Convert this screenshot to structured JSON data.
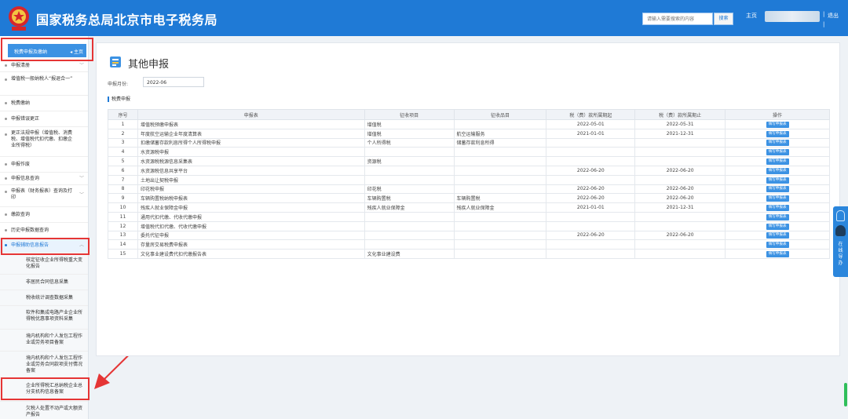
{
  "header": {
    "site_title": "国家税务总局北京市电子税务局",
    "search_placeholder": "请输入需要搜索的内容",
    "search_button": "搜索",
    "home_link": "主页",
    "separator": "|",
    "logout_link": "退出",
    "brand_color": "#1f7ad6"
  },
  "sidebar": {
    "head_label": "税费申报及缴纳",
    "head_home": "◂ 主页",
    "items": [
      {
        "label": "申报清册",
        "chev": "﹀"
      },
      {
        "label": "增值税一般纳税人“报退合一”",
        "chev": ""
      },
      {
        "label": "税费缴纳",
        "chev": ""
      },
      {
        "label": "申报错误更正",
        "chev": ""
      },
      {
        "label": "更正法规申报（增值税、消费税、增值税代扣代缴、扣缴企业所得税）",
        "chev": ""
      },
      {
        "label": "申报作废",
        "chev": ""
      },
      {
        "label": "申报信息查询",
        "chev": "﹀"
      },
      {
        "label": "申报表（财务报表）查询及打印",
        "chev": "﹀"
      },
      {
        "label": "缴款查询",
        "chev": ""
      },
      {
        "label": "历史申报数据查询",
        "chev": ""
      },
      {
        "label": "申报辅助信息报告",
        "chev": "︿"
      }
    ],
    "sub_items": [
      "核定征收企业所得税重大变化报告",
      "非居民合同信息采集",
      "税收统计调查数据采集",
      "软件和集成电路产业企业所得税优惠事项资料采集",
      "境内机构和个人发包工程作业或劳务项目备案",
      "境内机构和个人发包工程作业或劳务合同款项支付情况备案",
      "企业所得税汇总纳税企业总分支机构信息备案",
      "欠税人处置不动产或大额资产报告"
    ]
  },
  "main": {
    "title": "其他申报",
    "period_label": "申报月份:",
    "period_value": "2022-06",
    "section_title": "税费申报",
    "columns": [
      "序号",
      "申报表",
      "征收项目",
      "征收品目",
      "税（费）款所属期起",
      "税（费）款所属期止",
      "操作"
    ],
    "action_label": "填写申报表",
    "rows": [
      {
        "no": "1",
        "form": "增值税预缴申报表",
        "item": "增值税",
        "sub": "",
        "start": "2022-05-01",
        "end": "2022-05-31"
      },
      {
        "no": "2",
        "form": "年度航空运输企业年度清算表",
        "item": "增值税",
        "sub": "航空运输服务",
        "start": "2021-01-01",
        "end": "2021-12-31"
      },
      {
        "no": "3",
        "form": "扣缴储蓄存款利息所得个人所得税申报",
        "item": "个人所得税",
        "sub": "储蓄存款利息所得",
        "start": "",
        "end": ""
      },
      {
        "no": "4",
        "form": "水资源税申报",
        "item": "",
        "sub": "",
        "start": "",
        "end": ""
      },
      {
        "no": "5",
        "form": "水资源税税源信息采集表",
        "item": "资源税",
        "sub": "",
        "start": "",
        "end": ""
      },
      {
        "no": "6",
        "form": "水资源税信息共享平台",
        "item": "",
        "sub": "",
        "start": "2022-06-20",
        "end": "2022-06-20"
      },
      {
        "no": "7",
        "form": "土地出让契税申报",
        "item": "",
        "sub": "",
        "start": "",
        "end": ""
      },
      {
        "no": "8",
        "form": "印花税申报",
        "item": "印花税",
        "sub": "",
        "start": "2022-06-20",
        "end": "2022-06-20"
      },
      {
        "no": "9",
        "form": "车辆购置税纳税申报表",
        "item": "车辆购置税",
        "sub": "车辆购置税",
        "start": "2022-06-20",
        "end": "2022-06-20"
      },
      {
        "no": "10",
        "form": "残疾人就业保障金申报",
        "item": "残疾人就业保障金",
        "sub": "残疾人就业保障金",
        "start": "2021-01-01",
        "end": "2021-12-31"
      },
      {
        "no": "11",
        "form": "通用代扣代缴、代收代缴申报",
        "item": "",
        "sub": "",
        "start": "",
        "end": ""
      },
      {
        "no": "12",
        "form": "增值税代扣代缴、代收代缴申报",
        "item": "",
        "sub": "",
        "start": "",
        "end": ""
      },
      {
        "no": "13",
        "form": "委托代征申报",
        "item": "",
        "sub": "",
        "start": "2022-06-20",
        "end": "2022-06-20"
      },
      {
        "no": "14",
        "form": "存量房交易税费申报表",
        "item": "",
        "sub": "",
        "start": "",
        "end": ""
      },
      {
        "no": "15",
        "form": "文化事业建设费代扣代缴报告表",
        "item": "文化事业建设费",
        "sub": "",
        "start": "",
        "end": ""
      }
    ]
  },
  "float_panel": {
    "text": "在线导办"
  },
  "annotations": {
    "highlight_color": "#e53535"
  }
}
